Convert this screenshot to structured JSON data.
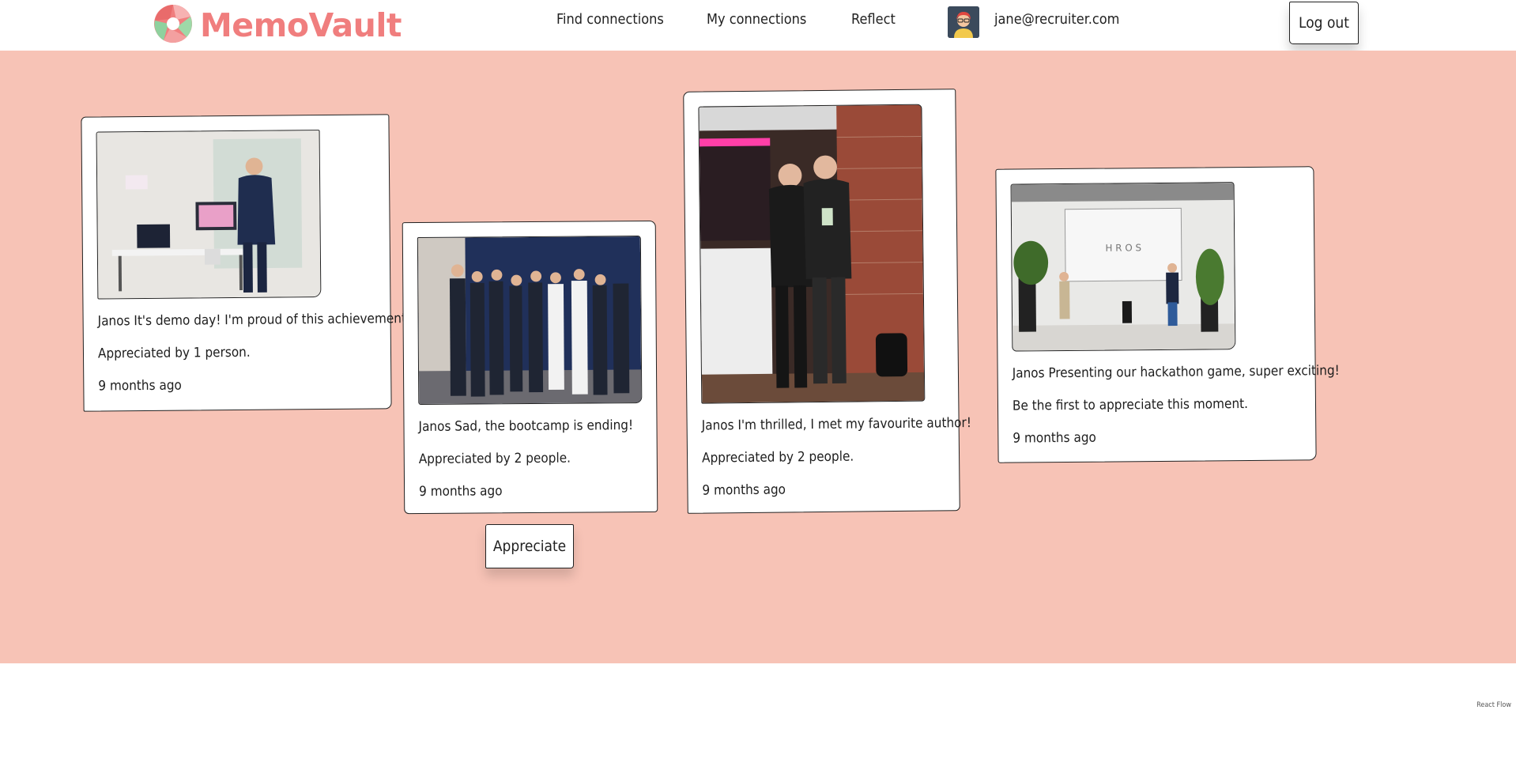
{
  "brand": {
    "name": "MemoVault",
    "logo_icon": "aperture-logo-icon"
  },
  "nav": {
    "links": [
      {
        "label": "Find connections"
      },
      {
        "label": "My connections"
      },
      {
        "label": "Reflect"
      }
    ],
    "user_email": "jane@recruiter.com",
    "logout_label": "Log out"
  },
  "colors": {
    "brand": "#f07e7e",
    "background": "#f7c3b6",
    "card": "#ffffff"
  },
  "moments": [
    {
      "author": "Janos",
      "text": "It's demo day! I'm proud of this achievement!",
      "caption": "Janos It's demo day! I'm proud of this achievement!",
      "appreciation": "Appreciated by 1 person.",
      "time": "9 months ago"
    },
    {
      "author": "Janos",
      "text": "Sad, the bootcamp is ending!",
      "caption": "Janos Sad, the bootcamp is ending!",
      "appreciation": "Appreciated by 2 people.",
      "time": "9 months ago"
    },
    {
      "author": "Janos",
      "text": "I'm thrilled, I met my favourite author!",
      "caption": "Janos I'm thrilled, I met my favourite author!",
      "appreciation": "Appreciated by 2 people.",
      "time": "9 months ago"
    },
    {
      "author": "Janos",
      "text": "Presenting our hackathon game, super exciting!",
      "caption": "Janos Presenting our hackathon game, super exciting!",
      "appreciation": "Be the first to appreciate this moment.",
      "time": "9 months ago"
    }
  ],
  "appreciate_label": "Appreciate",
  "credit": "React Flow"
}
